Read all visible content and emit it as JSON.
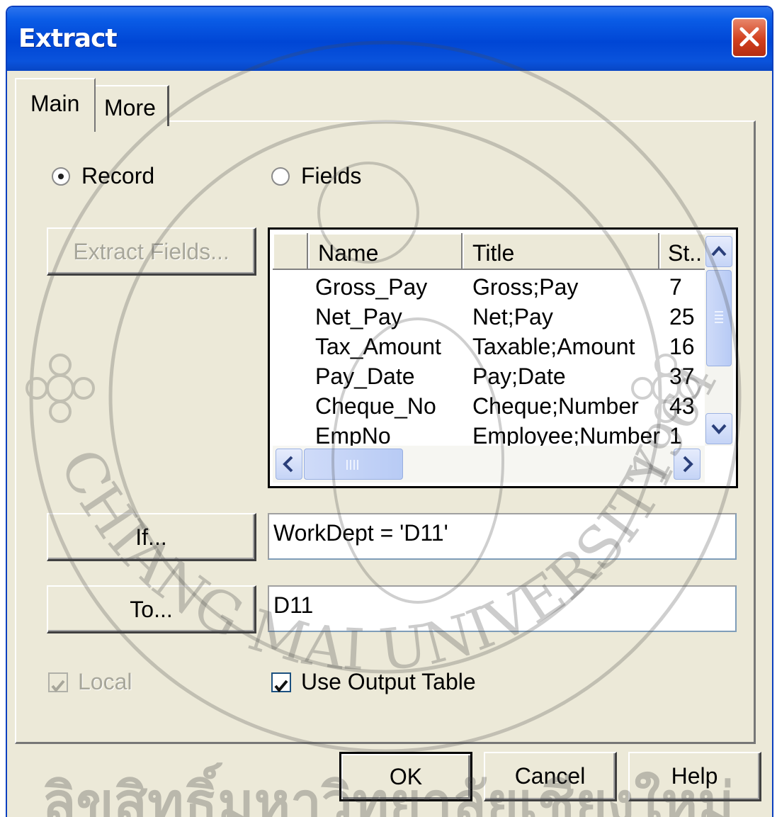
{
  "window": {
    "title": "Extract",
    "close_icon": "close-icon"
  },
  "tabs": [
    {
      "label": "Main",
      "selected": true
    },
    {
      "label": "More",
      "selected": false
    }
  ],
  "mode": {
    "record_label": "Record",
    "fields_label": "Fields",
    "selected": "Record"
  },
  "buttons": {
    "extract_fields": "Extract Fields...",
    "if": "If...",
    "to": "To...",
    "ok": "OK",
    "cancel": "Cancel",
    "help": "Help"
  },
  "field_list": {
    "columns": [
      "Name",
      "Title",
      "St.."
    ],
    "rows": [
      {
        "name": "Gross_Pay",
        "title": "Gross;Pay",
        "st": "7"
      },
      {
        "name": "Net_Pay",
        "title": "Net;Pay",
        "st": "25"
      },
      {
        "name": "Tax_Amount",
        "title": "Taxable;Amount",
        "st": "16"
      },
      {
        "name": "Pay_Date",
        "title": "Pay;Date",
        "st": "37"
      },
      {
        "name": "Cheque_No",
        "title": "Cheque;Number",
        "st": "43"
      },
      {
        "name": "EmpNo",
        "title": "Employee;Number",
        "st": "1"
      }
    ]
  },
  "if_expression": "WorkDept = 'D11'",
  "to_table": "D11",
  "options": {
    "local_label": "Local",
    "local_checked": true,
    "local_enabled": false,
    "use_output_table_label": "Use Output Table",
    "use_output_table_checked": true
  },
  "watermark": {
    "top_text": "ลิขสิทธิ์มหาวิทยาลัยเชียงใหม่",
    "arc_text": "CHIANG MAI UNIVERSITY",
    "year": "1964"
  },
  "colors": {
    "title_bar": "#0a5ce6",
    "dialog_bg": "#ece9d8",
    "close_button": "#d2401e"
  }
}
